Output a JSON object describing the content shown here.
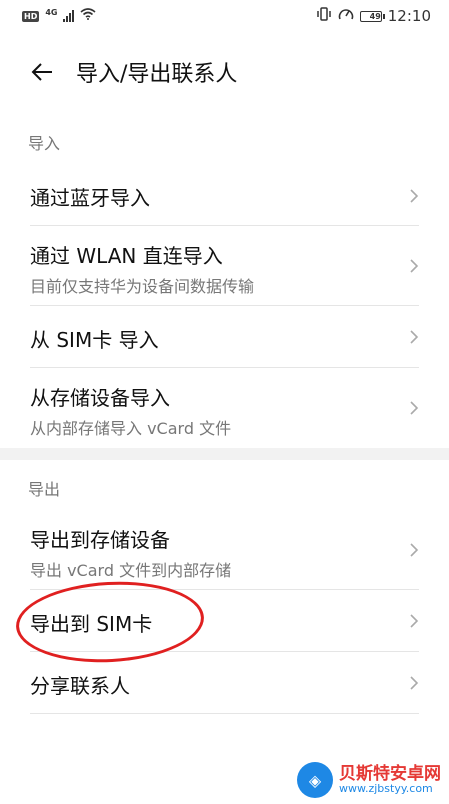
{
  "status_bar": {
    "hd_label": "HD",
    "network_type": "4G",
    "battery_level": "49",
    "battery_fraction": 0.49,
    "time": "12:10",
    "icons": [
      "hd-icon",
      "signal-icon",
      "wifi-icon",
      "vibrate-icon",
      "speedometer-icon",
      "battery-icon"
    ]
  },
  "toolbar": {
    "back_icon": "arrow-left-icon",
    "title": "导入/导出联系人"
  },
  "sections": {
    "import": {
      "header": "导入",
      "items": [
        {
          "title": "通过蓝牙导入",
          "subtitle": ""
        },
        {
          "title": "通过 WLAN 直连导入",
          "subtitle": "目前仅支持华为设备间数据传输"
        },
        {
          "title": "从 SIM卡 导入",
          "subtitle": ""
        },
        {
          "title": "从存储设备导入",
          "subtitle": "从内部存储导入 vCard 文件"
        }
      ]
    },
    "export": {
      "header": "导出",
      "items": [
        {
          "title": "导出到存储设备",
          "subtitle": "导出 vCard 文件到内部存储"
        },
        {
          "title": "导出到 SIM卡",
          "subtitle": ""
        },
        {
          "title": "分享联系人",
          "subtitle": ""
        }
      ]
    }
  },
  "annotation": {
    "color": "#e02020"
  },
  "watermark": {
    "name": "贝斯特安卓网",
    "url": "www.zjbstyy.com"
  },
  "colors": {
    "text_primary": "#111111",
    "text_secondary": "#777777",
    "divider": "#e5e5e5"
  }
}
